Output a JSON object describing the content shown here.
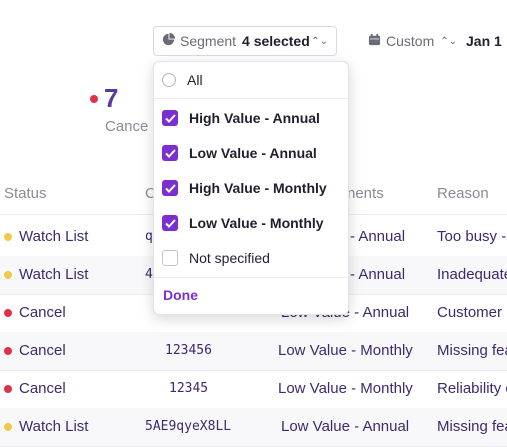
{
  "toolbar": {
    "segment_label": "Segment",
    "segment_value": "4 selected",
    "custom_label": "Custom",
    "date_label": "Jan 1"
  },
  "stat": {
    "value": "7",
    "label": "Cance"
  },
  "table": {
    "headers": [
      "Status",
      "C",
      "nents",
      "Reason"
    ],
    "rows": [
      {
        "status": "Watch List",
        "status_color": "#f2c94c",
        "code": "q",
        "plan": "- Annual",
        "reason": "Too busy -"
      },
      {
        "status": "Watch List",
        "status_color": "#f2c94c",
        "code": "4",
        "plan": "- Annual",
        "reason": "Inadequate"
      },
      {
        "status": "Cancel",
        "status_color": "#e0314b",
        "code": "",
        "plan": "Low Value - Annual",
        "reason": "Customer"
      },
      {
        "status": "Cancel",
        "status_color": "#e0314b",
        "code": "123456",
        "plan": "Low Value - Monthly",
        "reason": "Missing fea"
      },
      {
        "status": "Cancel",
        "status_color": "#e0314b",
        "code": "12345",
        "plan": "Low Value - Monthly",
        "reason": "Reliability c"
      },
      {
        "status": "Watch List",
        "status_color": "#f2c94c",
        "code": "5AE9qyeX8LL",
        "plan": "Low Value - Annual",
        "reason": "Missing fea"
      }
    ]
  },
  "dropdown": {
    "all_label": "All",
    "options": [
      {
        "label": "High Value - Annual",
        "checked": true
      },
      {
        "label": "Low Value - Annual",
        "checked": true
      },
      {
        "label": "High Value - Monthly",
        "checked": true
      },
      {
        "label": "Low Value - Monthly",
        "checked": true
      },
      {
        "label": "Not specified",
        "checked": false
      }
    ],
    "done_label": "Done"
  },
  "colors": {
    "accent": "#7b2fd0",
    "cancel": "#e0314b",
    "watch": "#f2c94c"
  },
  "icons": {
    "segment": "pie-chart-icon",
    "custom": "calendar-icon",
    "chevron": "chevron-updown-icon"
  }
}
